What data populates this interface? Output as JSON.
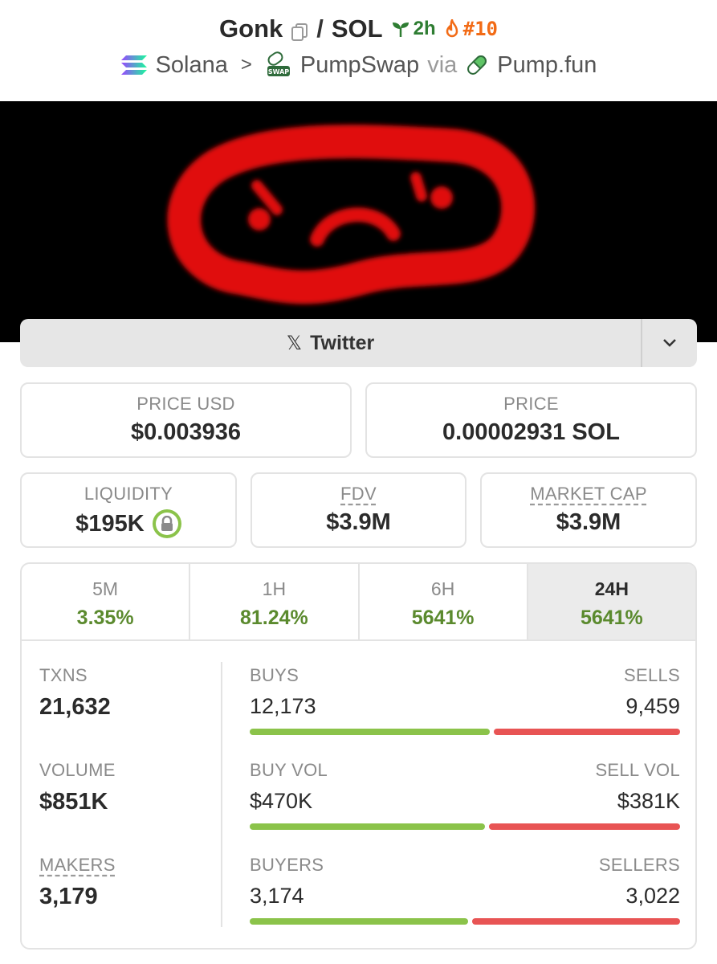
{
  "header": {
    "token": "Gonk",
    "separator": "/",
    "quote": "SOL",
    "age": "2h",
    "trend_rank": "#10",
    "chain": "Solana",
    "dex": "PumpSwap",
    "via": "via",
    "launchpad": "Pump.fun"
  },
  "social": {
    "twitter_label": "Twitter"
  },
  "prices": {
    "price_usd_label": "PRICE USD",
    "price_usd": "$0.003936",
    "price_label": "PRICE",
    "price_native": "0.00002931 SOL"
  },
  "metrics": {
    "liquidity_label": "LIQUIDITY",
    "liquidity": "$195K",
    "fdv_label": "FDV",
    "fdv": "$3.9M",
    "mcap_label": "MARKET CAP",
    "mcap": "$3.9M"
  },
  "timeframes": [
    {
      "label": "5M",
      "change": "3.35%"
    },
    {
      "label": "1H",
      "change": "81.24%"
    },
    {
      "label": "6H",
      "change": "5641%"
    },
    {
      "label": "24H",
      "change": "5641%"
    }
  ],
  "stats": {
    "txns_label": "TXNS",
    "txns": "21,632",
    "volume_label": "VOLUME",
    "volume": "$851K",
    "makers_label": "MAKERS",
    "makers": "3,179",
    "buys_label": "BUYS",
    "buys": "12,173",
    "sells_label": "SELLS",
    "sells": "9,459",
    "buy_vol_label": "BUY VOL",
    "buy_vol": "$470K",
    "sell_vol_label": "SELL VOL",
    "sell_vol": "$381K",
    "buyers_label": "BUYERS",
    "buyers": "3,174",
    "sellers_label": "SELLERS",
    "sellers": "3,022",
    "buy_share_txns": 0.563,
    "buy_share_vol": 0.552,
    "buy_share_makers": 0.512
  },
  "colors": {
    "positive": "#5b8a2e",
    "buy_bar": "#8bc34a",
    "sell_bar": "#e85454",
    "trend": "#f26b16",
    "banner_face": "#e01010"
  }
}
